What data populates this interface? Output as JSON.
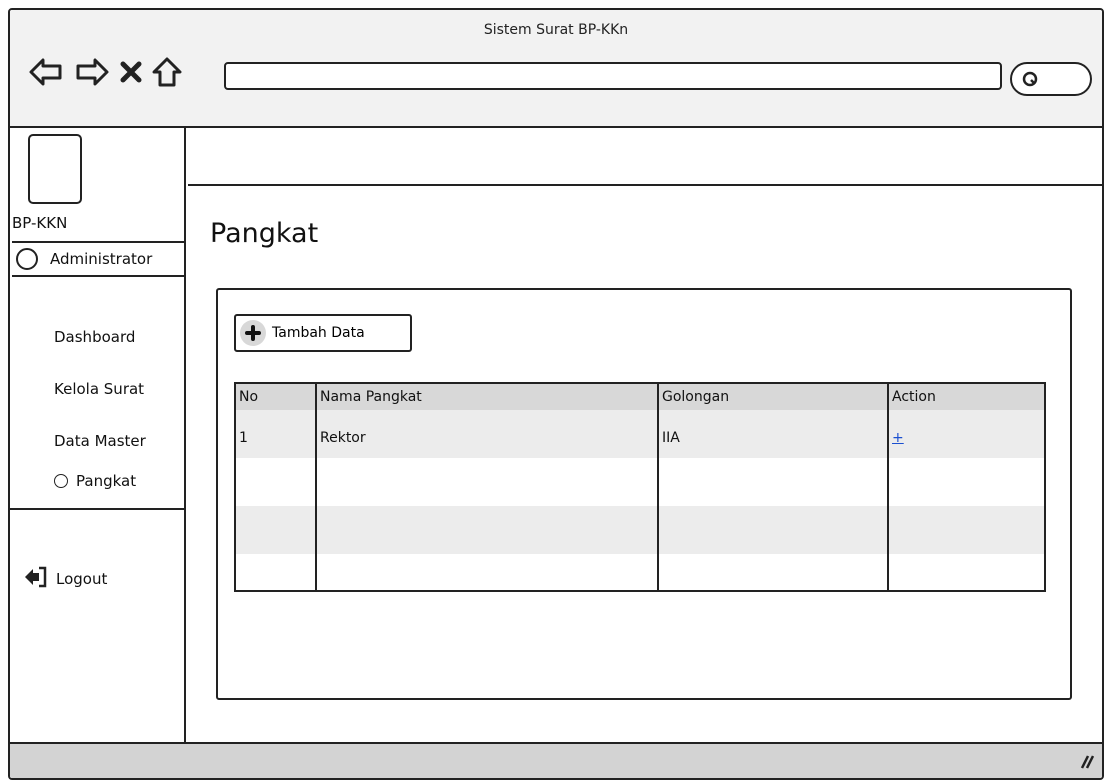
{
  "window": {
    "title": "Sistem Surat BP-KKn"
  },
  "browser": {
    "nav_icons": [
      "back-arrow-icon",
      "forward-arrow-icon",
      "close-icon",
      "home-icon"
    ],
    "url_value": "",
    "search_icon": "search-icon"
  },
  "sidebar": {
    "brand": "BP-KKN",
    "user": "Administrator",
    "menu": [
      {
        "label": "Dashboard"
      },
      {
        "label": "Kelola Surat"
      },
      {
        "label": "Data Master"
      }
    ],
    "submenu": [
      {
        "label": "Pangkat"
      }
    ],
    "logout": "Logout"
  },
  "main": {
    "title": "Pangkat",
    "add_button": "Tambah Data",
    "table": {
      "headers": [
        "No",
        "Nama Pangkat",
        "Golongan",
        "Action"
      ],
      "rows": [
        {
          "no": "1",
          "nama": "Rektor",
          "golongan": "IIA",
          "action": "+"
        }
      ]
    }
  },
  "colors": {
    "header_gray": "#d8d8d8",
    "row_alt": "#ececec",
    "link_blue": "#1a4fd0"
  }
}
